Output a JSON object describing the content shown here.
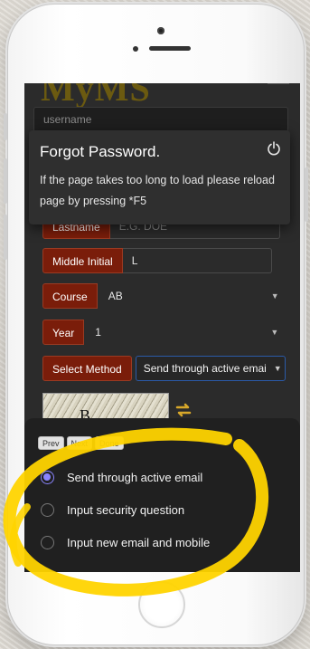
{
  "app": {
    "logo_text": "MyMS"
  },
  "login": {
    "username_placeholder": "username"
  },
  "toast": {
    "title": "Forgot Password.",
    "message": "If the page takes too long to load please reload page by pressing *F5"
  },
  "form": {
    "lastname": {
      "label": "Lastname",
      "placeholder": "E.G. DOE"
    },
    "middle_initial": {
      "label": "Middle Initial",
      "value": "L"
    },
    "course": {
      "label": "Course",
      "value": "AB"
    },
    "year": {
      "label": "Year",
      "value": "1"
    },
    "select_method": {
      "label": "Select Method",
      "value": "Send through active emai"
    },
    "captcha_text": "B"
  },
  "picker": {
    "toolbar": {
      "prev": "Prev",
      "next": "Next",
      "done": "Done"
    },
    "options": [
      {
        "label": "Send through active email",
        "selected": true
      },
      {
        "label": "Input security question",
        "selected": false
      },
      {
        "label": "Input new email and mobile",
        "selected": false
      }
    ]
  },
  "colors": {
    "label_bg": "#7a1d0a",
    "radio_selected": "#8a84ff",
    "highlight": "#ffd400",
    "focus_border": "#2b5aa8"
  }
}
